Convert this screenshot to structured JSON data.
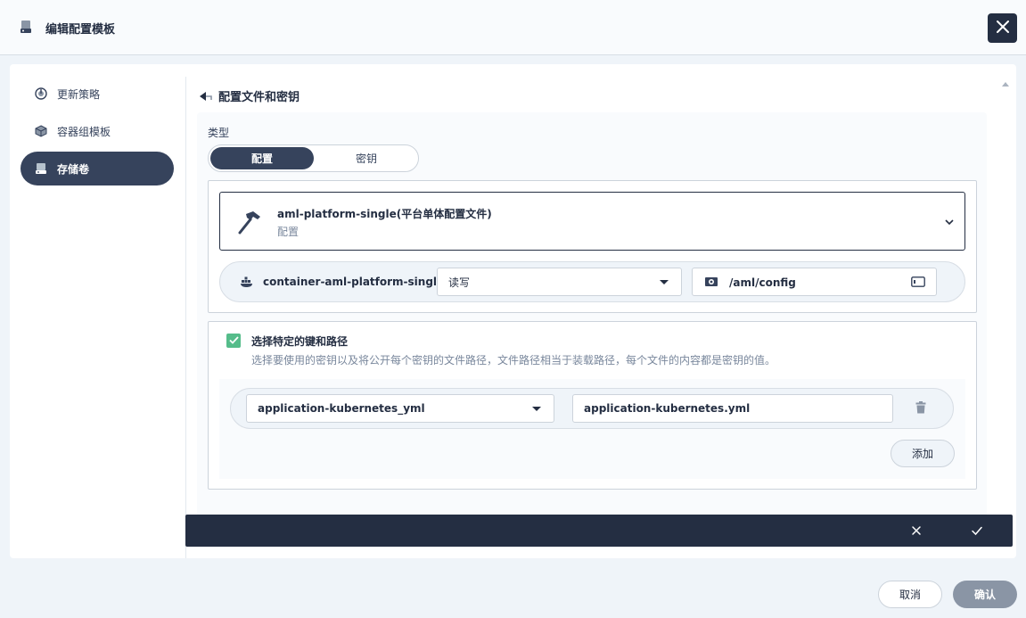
{
  "header": {
    "title": "编辑配置模板",
    "title_icon": "storage-icon",
    "close_icon": "close-icon"
  },
  "sidebar": {
    "items": [
      {
        "label": "更新策略",
        "icon": "update-strategy-icon",
        "active": false
      },
      {
        "label": "容器组模板",
        "icon": "pod-template-icon",
        "active": false
      },
      {
        "label": "存储卷",
        "icon": "storage-volume-icon",
        "active": true
      }
    ]
  },
  "panel": {
    "title": "配置文件和密钥",
    "type_label": "类型",
    "type_options": [
      "配置",
      "密钥"
    ],
    "selected_type": "配置",
    "config": {
      "name": "aml-platform-single(平台单体配置文件)",
      "subtitle": "配置"
    },
    "mount": {
      "container": "container-aml-platform-single",
      "access_mode": "读写",
      "mount_path": "/aml/config"
    },
    "specific_keys": {
      "checked": true,
      "title": "选择特定的键和路径",
      "description": "选择要使用的密钥以及将公开每个密钥的文件路径，文件路径相当于装载路径，每个文件的内容都是密钥的值。",
      "rows": [
        {
          "key": "application-kubernetes_yml",
          "path": "application-kubernetes.yml"
        }
      ],
      "add_label": "添加"
    }
  },
  "footer": {
    "cancel_label": "取消",
    "confirm_label": "确认"
  },
  "colors": {
    "dark": "#242e42",
    "accent_green": "#55bc8a",
    "nav_active": "#36435c"
  }
}
